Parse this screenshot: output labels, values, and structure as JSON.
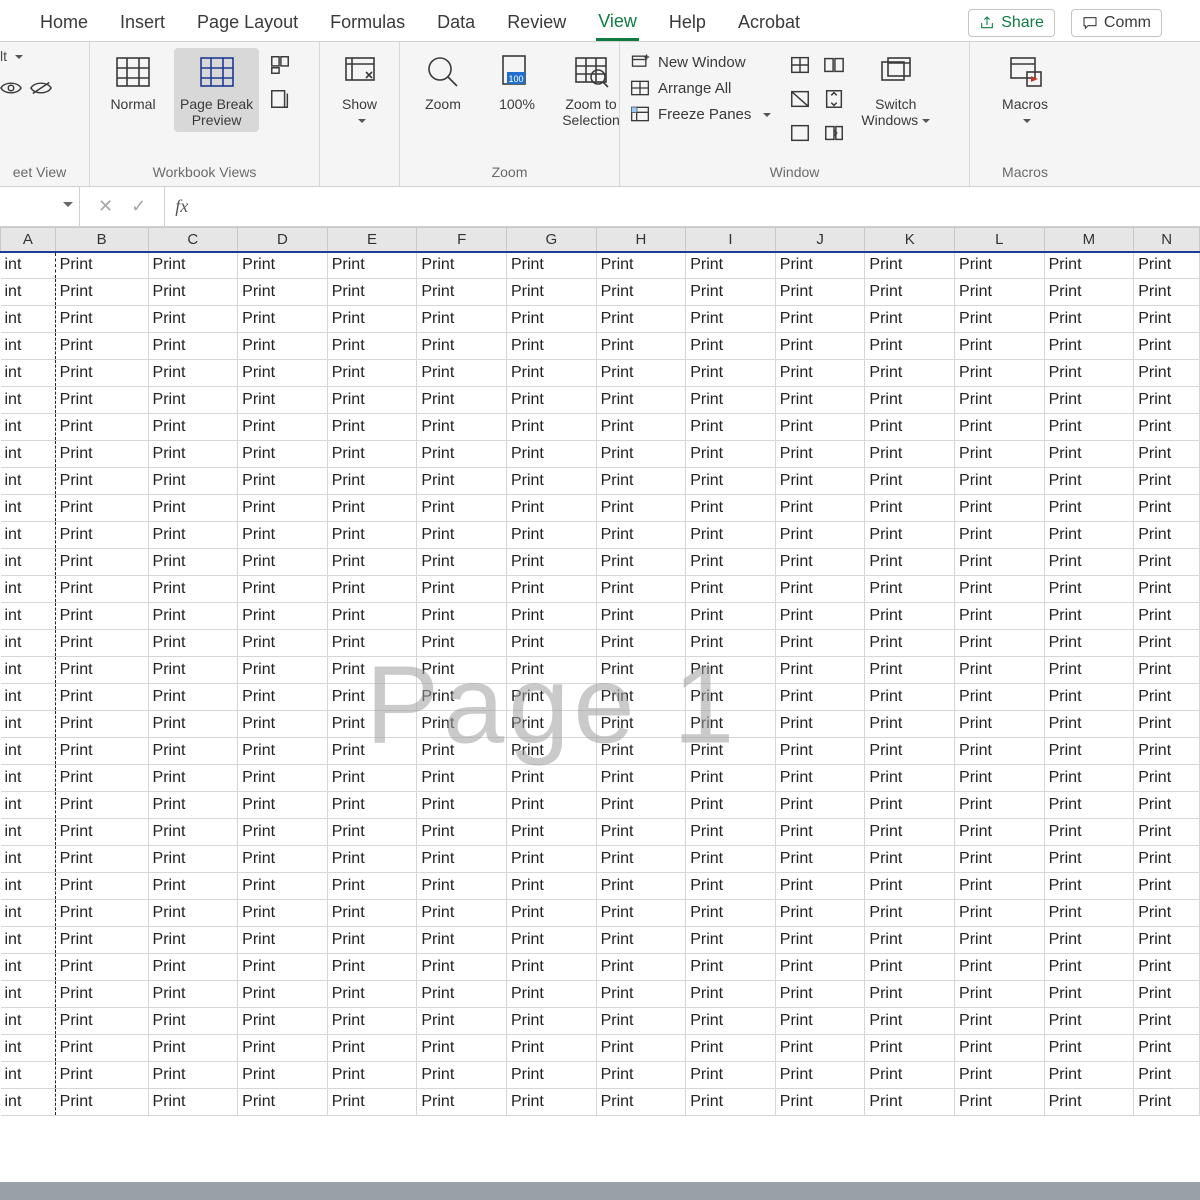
{
  "tabs": {
    "items": [
      "Home",
      "Insert",
      "Page Layout",
      "Formulas",
      "Data",
      "Review",
      "View",
      "Help",
      "Acrobat"
    ],
    "active": "View",
    "share": "Share",
    "comments": "Comm"
  },
  "ribbon": {
    "sheet_view_label": "eet View",
    "sheet_view_partial": "lt",
    "workbook_views": {
      "label": "Workbook Views",
      "normal": "Normal",
      "page_break": "Page Break\nPreview"
    },
    "show": {
      "label": "Show"
    },
    "zoom": {
      "group_label": "Zoom",
      "zoom": "Zoom",
      "hundred": "100%",
      "to_selection": "Zoom to\nSelection"
    },
    "window": {
      "group_label": "Window",
      "new_window": "New Window",
      "arrange_all": "Arrange All",
      "freeze": "Freeze Panes",
      "switch": "Switch\nWindows"
    },
    "macros": {
      "group_label": "Macros",
      "label": "Macros"
    }
  },
  "formula_bar": {
    "fx": "fx",
    "value": ""
  },
  "grid": {
    "columns": [
      "A",
      "B",
      "C",
      "D",
      "E",
      "F",
      "G",
      "H",
      "I",
      "J",
      "K",
      "L",
      "M",
      "N"
    ],
    "rows": 32,
    "cell_value": "Print",
    "first_cell_value": "int",
    "watermark": "Page 1"
  }
}
